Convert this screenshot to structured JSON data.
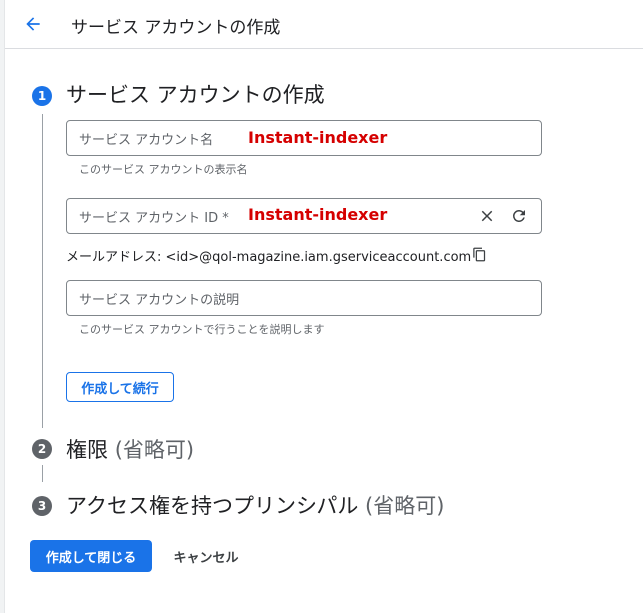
{
  "header": {
    "title": "サービス アカウントの作成"
  },
  "steps": [
    {
      "number": "1",
      "title": "サービス アカウントの作成",
      "optional": ""
    },
    {
      "number": "2",
      "title": "権限",
      "optional": "(省略可)"
    },
    {
      "number": "3",
      "title": "アクセス権を持つプリンシパル",
      "optional": "(省略可)"
    }
  ],
  "form": {
    "name_field": {
      "placeholder": "サービス アカウント名",
      "annotation": "Instant-indexer",
      "hint": "このサービス アカウントの表示名"
    },
    "id_field": {
      "placeholder": "サービス アカウント ID *",
      "annotation": "Instant-indexer"
    },
    "email": {
      "text": "メールアドレス: <id>@qol-magazine.iam.gserviceaccount.com"
    },
    "description_field": {
      "placeholder": "サービス アカウントの説明",
      "hint": "このサービス アカウントで行うことを説明します"
    },
    "continue_label": "作成して続行"
  },
  "footer": {
    "create_close_label": "作成して閉じる",
    "cancel_label": "キャンセル"
  },
  "colors": {
    "accent": "#1a73e8",
    "step_inactive": "#5f6368",
    "annotation": "#d50000"
  },
  "icons": [
    "arrow-back-icon",
    "clear-icon",
    "refresh-icon",
    "copy-icon"
  ]
}
